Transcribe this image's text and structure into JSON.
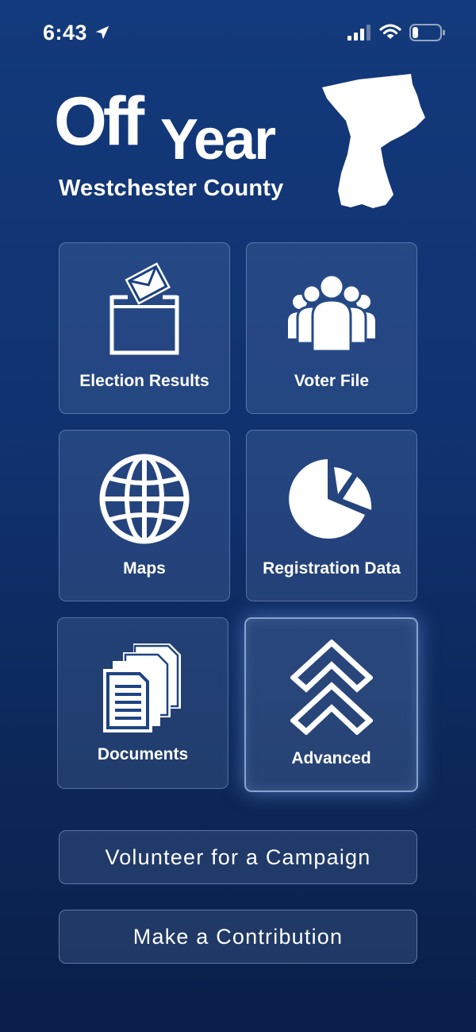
{
  "status_bar": {
    "time": "6:43",
    "icons": [
      "location-arrow-icon",
      "cellular-signal-icon",
      "wifi-icon",
      "battery-icon"
    ]
  },
  "logo": {
    "word_off": "Off",
    "word_year": "Year",
    "county": "Westchester County",
    "map_icon": "westchester-county-map-icon"
  },
  "tiles": [
    {
      "label": "Election Results",
      "icon": "ballot-box-icon"
    },
    {
      "label": "Voter File",
      "icon": "people-group-icon"
    },
    {
      "label": "Maps",
      "icon": "globe-icon"
    },
    {
      "label": "Registration Data",
      "icon": "pie-chart-icon"
    },
    {
      "label": "Documents",
      "icon": "documents-stack-icon"
    },
    {
      "label": "Advanced",
      "icon": "double-chevron-up-icon"
    }
  ],
  "buttons": {
    "volunteer": "Volunteer for a Campaign",
    "contribute": "Make a Contribution"
  },
  "colors": {
    "background_top": "#133a7c",
    "background_bottom": "#0a1f49",
    "text": "#ffffff"
  }
}
